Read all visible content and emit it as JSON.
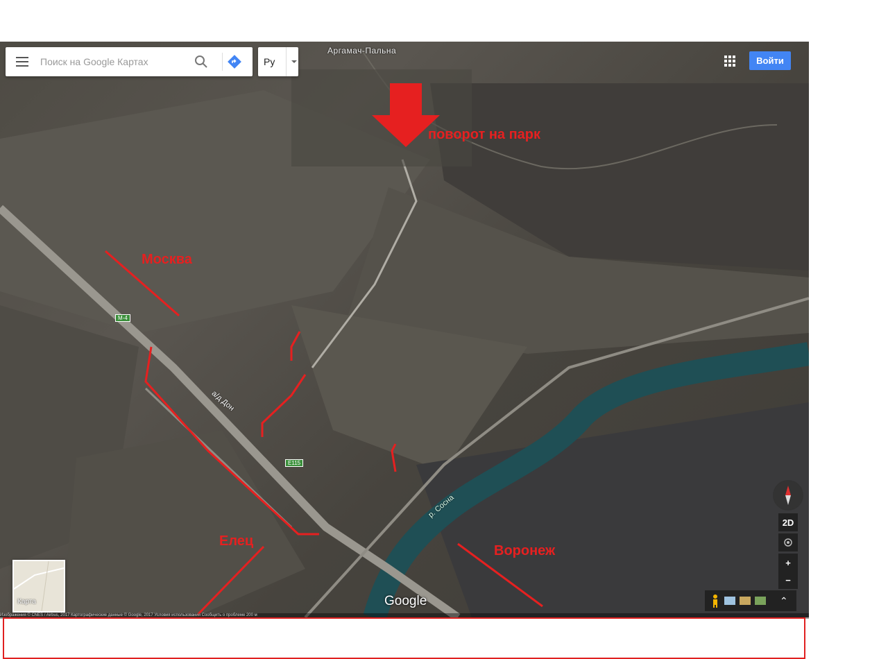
{
  "search": {
    "placeholder": "Поиск на Google Картах"
  },
  "language": {
    "label": "Ру"
  },
  "header": {
    "login_label": "Войти"
  },
  "map": {
    "place_label": "Аргамач-Пальна",
    "roads": {
      "m4": "M-4",
      "e115": "E115",
      "road_name": "а/д Дон"
    },
    "river_label": "р. Сосна",
    "minimap_label": "Карта",
    "logo": "Google",
    "footer_text": "Изображения © CNES / Airbus, 2017 Картографические данные © Google, 2017 Условия использования Сообщить о проблеме 200 м"
  },
  "controls": {
    "view_2d": "2D",
    "zoom_in": "+",
    "zoom_out": "−",
    "expand": "⌃"
  },
  "annotations": {
    "turn_to_park": "поворот на парк",
    "moscow": "Москва",
    "yelets": "Елец",
    "voronezh": "Воронеж"
  },
  "colors": {
    "annotation": "#e62020",
    "login_button": "#4285f4",
    "river": "#1f4f55"
  }
}
